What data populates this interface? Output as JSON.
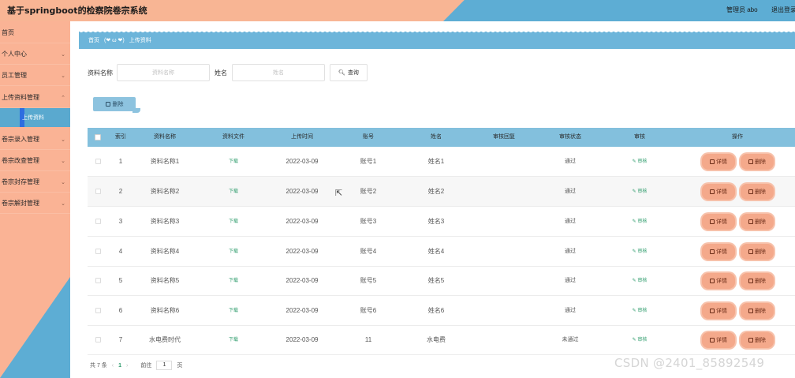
{
  "header": {
    "title": "基于springboot的检察院卷宗系统",
    "admin": "管理员 abo",
    "logout": "退出登录"
  },
  "sidebar": {
    "items": [
      {
        "label": "首页"
      },
      {
        "label": "个人中心"
      },
      {
        "label": "员工管理"
      },
      {
        "label": "上传资料管理"
      },
      {
        "label": "上传资料"
      },
      {
        "label": "卷宗录入管理"
      },
      {
        "label": "卷宗改查管理"
      },
      {
        "label": "卷宗封存管理"
      },
      {
        "label": "卷宗解封管理"
      }
    ]
  },
  "breadcrumb": {
    "home": "首页",
    "separator": "(❤ ω ❤)",
    "current": "上传资料"
  },
  "search": {
    "name_label": "资料名称",
    "name_placeholder": "资料名称",
    "person_label": "姓名",
    "person_placeholder": "姓名",
    "query_button": "查询"
  },
  "toolbar": {
    "delete_label": "删除"
  },
  "table": {
    "columns": [
      "索引",
      "资料名称",
      "资料文件",
      "上传时间",
      "账号",
      "姓名",
      "审核回复",
      "审核状态",
      "审核",
      "操作"
    ],
    "download_label": "下载",
    "audit_label": "审核",
    "detail_label": "详情",
    "delete_label": "删除",
    "rows": [
      {
        "index": "1",
        "name": "资料名称1",
        "time": "2022-03-09",
        "account": "账号1",
        "person": "姓名1",
        "reply": "",
        "status": "通过"
      },
      {
        "index": "2",
        "name": "资料名称2",
        "time": "2022-03-09",
        "account": "账号2",
        "person": "姓名2",
        "reply": "",
        "status": "通过"
      },
      {
        "index": "3",
        "name": "资料名称3",
        "time": "2022-03-09",
        "account": "账号3",
        "person": "姓名3",
        "reply": "",
        "status": "通过"
      },
      {
        "index": "4",
        "name": "资料名称4",
        "time": "2022-03-09",
        "account": "账号4",
        "person": "姓名4",
        "reply": "",
        "status": "通过"
      },
      {
        "index": "5",
        "name": "资料名称5",
        "time": "2022-03-09",
        "account": "账号5",
        "person": "姓名5",
        "reply": "",
        "status": "通过"
      },
      {
        "index": "6",
        "name": "资料名称6",
        "time": "2022-03-09",
        "account": "账号6",
        "person": "姓名6",
        "reply": "",
        "status": "通过"
      },
      {
        "index": "7",
        "name": "水电费时代",
        "time": "2022-03-09",
        "account": "11",
        "person": "水电费",
        "reply": "",
        "status": "未通过"
      }
    ]
  },
  "pagination": {
    "total": "共 7 条",
    "prev": "‹",
    "current_page": "1",
    "next": "›",
    "goto_label": "前往",
    "goto_value": "1",
    "page_unit": "页"
  },
  "watermark": "CSDN @2401_85892549",
  "colors": {
    "header_peach": "#f8b594",
    "header_blue": "#5dadd4",
    "sidebar_peach": "#fab395",
    "table_head": "#83c0dd",
    "action_button": "#f4a98b",
    "link_green": "#2e9c6c"
  }
}
